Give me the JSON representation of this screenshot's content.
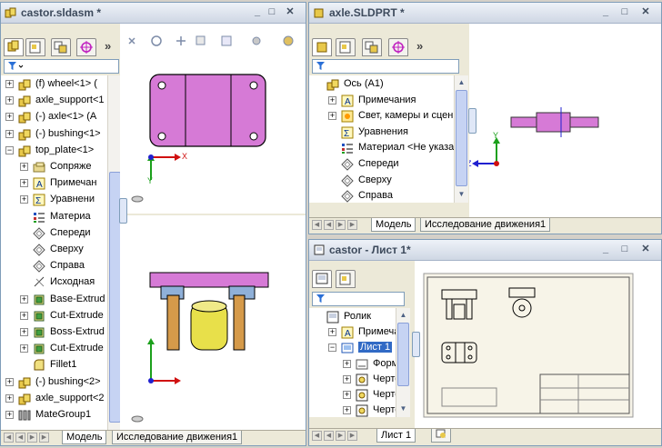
{
  "left_window": {
    "title": "castor.sldasm *",
    "more_chevron": "»",
    "tree": [
      {
        "label": "(f) wheel<1> (",
        "icon": "part-yellow-icon",
        "expand": "+",
        "indent": 0
      },
      {
        "label": "axle_support<1",
        "icon": "part-yellow-icon",
        "expand": "+",
        "indent": 0
      },
      {
        "label": "(-) axle<1> (A",
        "icon": "part-yellow-icon",
        "expand": "+",
        "indent": 0
      },
      {
        "label": "(-) bushing<1>",
        "icon": "part-yellow-icon",
        "expand": "+",
        "indent": 0
      },
      {
        "label": "top_plate<1>",
        "icon": "part-yellow-icon",
        "expand": "−",
        "indent": 0
      },
      {
        "label": "Сопряже",
        "icon": "folder-icon",
        "expand": "+",
        "indent": 1
      },
      {
        "label": "Примечан",
        "icon": "annotation-icon",
        "expand": "+",
        "indent": 1
      },
      {
        "label": "Уравнени",
        "icon": "equation-icon",
        "expand": "+",
        "indent": 1
      },
      {
        "label": "Материа",
        "icon": "material-icon",
        "expand": "",
        "indent": 1
      },
      {
        "label": "Спереди",
        "icon": "plane-icon",
        "expand": "",
        "indent": 1
      },
      {
        "label": "Сверху",
        "icon": "plane-icon",
        "expand": "",
        "indent": 1
      },
      {
        "label": "Справа",
        "icon": "plane-icon",
        "expand": "",
        "indent": 1
      },
      {
        "label": "Исходная",
        "icon": "origin-icon",
        "expand": "",
        "indent": 1
      },
      {
        "label": "Base-Extrud",
        "icon": "extrude-icon",
        "expand": "+",
        "indent": 1
      },
      {
        "label": "Cut-Extrude",
        "icon": "extrude-icon",
        "expand": "+",
        "indent": 1
      },
      {
        "label": "Boss-Extrud",
        "icon": "extrude-icon",
        "expand": "+",
        "indent": 1
      },
      {
        "label": "Cut-Extrude",
        "icon": "extrude-icon",
        "expand": "+",
        "indent": 1
      },
      {
        "label": "Fillet1",
        "icon": "fillet-icon",
        "expand": "",
        "indent": 1
      },
      {
        "label": "(-) bushing<2>",
        "icon": "part-yellow-icon",
        "expand": "+",
        "indent": 0
      },
      {
        "label": "axle_support<2",
        "icon": "part-yellow-icon",
        "expand": "+",
        "indent": 0
      },
      {
        "label": "MateGroup1",
        "icon": "mategroup-icon",
        "expand": "+",
        "indent": 0
      }
    ],
    "tabs": [
      "Модель",
      "Исследование движения1"
    ],
    "axis_x": "X",
    "axis_y": "Y"
  },
  "top_right_window": {
    "title": "axle.SLDPRT *",
    "more_chevron": "»",
    "tree": [
      {
        "label": "Ось (A1)",
        "icon": "part-yellow-icon",
        "expand": "",
        "indent": 0
      },
      {
        "label": "Примечания",
        "icon": "annotation-icon",
        "expand": "+",
        "indent": 1
      },
      {
        "label": "Свет, камеры и сцены",
        "icon": "lights-icon",
        "expand": "+",
        "indent": 1
      },
      {
        "label": "Уравнения",
        "icon": "equation-icon",
        "expand": "",
        "indent": 1
      },
      {
        "label": "Материал <Не указан>",
        "icon": "material-icon",
        "expand": "",
        "indent": 1
      },
      {
        "label": "Спереди",
        "icon": "plane-icon",
        "expand": "",
        "indent": 1
      },
      {
        "label": "Сверху",
        "icon": "plane-icon",
        "expand": "",
        "indent": 1
      },
      {
        "label": "Справа",
        "icon": "plane-icon",
        "expand": "",
        "indent": 1
      }
    ],
    "tabs": [
      "Модель",
      "Исследование движения1"
    ],
    "axis_x": "X",
    "axis_y": "Y",
    "axis_z": "Z"
  },
  "bottom_right_window": {
    "title": "castor - Лист 1*",
    "tree": [
      {
        "label": "Ролик",
        "icon": "drawing-icon",
        "expand": "",
        "indent": 0
      },
      {
        "label": "Примечани",
        "icon": "annotation-icon",
        "expand": "+",
        "indent": 1
      },
      {
        "label": "Лист 1",
        "icon": "sheet-icon",
        "expand": "−",
        "indent": 1,
        "selected": true
      },
      {
        "label": "Формат",
        "icon": "format-icon",
        "expand": "+",
        "indent": 2
      },
      {
        "label": "Чертеж",
        "icon": "view-icon",
        "expand": "+",
        "indent": 2
      },
      {
        "label": "Чертеж",
        "icon": "view-icon",
        "expand": "+",
        "indent": 2
      },
      {
        "label": "Чертеж",
        "icon": "view-icon",
        "expand": "+",
        "indent": 2
      }
    ],
    "tabs": [
      "Лист 1"
    ]
  },
  "colors": {
    "part_magenta": "#d67ad6",
    "wheel_yellow": "#e8e04a",
    "support_orange": "#d59a4a",
    "bushing_blue": "#8fb0d8",
    "tree_selected": "#316ac5"
  }
}
